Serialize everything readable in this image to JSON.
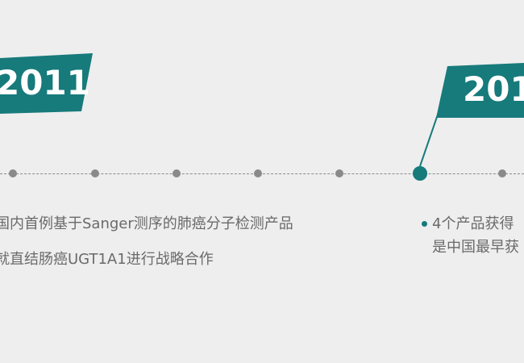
{
  "timeline": {
    "left_year": "2011",
    "right_year": "201",
    "left_items": [
      "国内首例基于Sanger测序的肺癌分子检测产品",
      "就直结肠癌UGT1A1进行战略合作"
    ],
    "right_items": [
      "4个产品获得",
      "是中国最早获"
    ]
  },
  "colors": {
    "accent": "#177a7b",
    "background": "#eeeeee",
    "text": "#6a6a6a",
    "dot": "#8a8a8a"
  }
}
